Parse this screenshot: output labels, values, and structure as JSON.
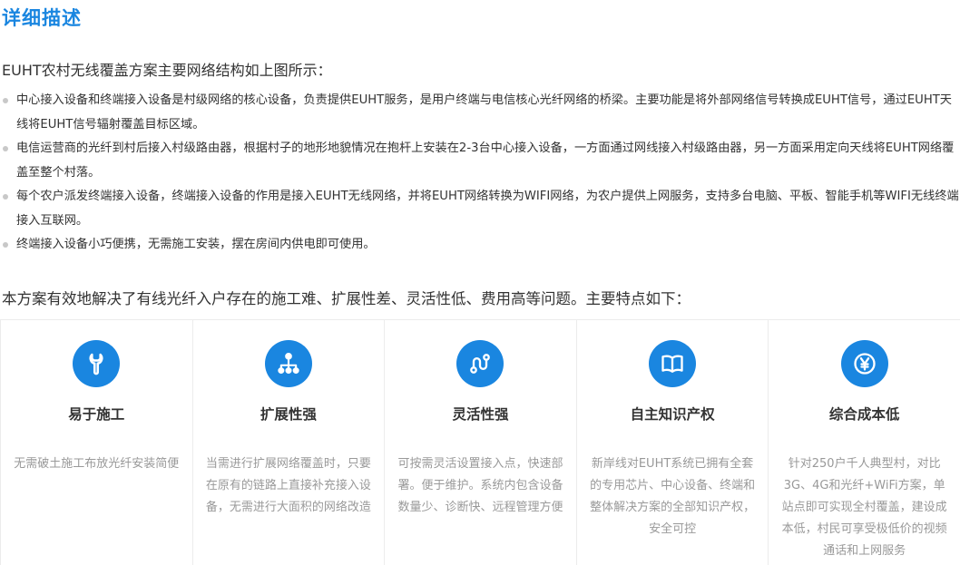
{
  "title": "详细描述",
  "intro": "EUHT农村无线覆盖方案主要网络结构如上图所示：",
  "bullets": [
    "中心接入设备和终端接入设备是村级网络的核心设备，负责提供EUHT服务，是用户终端与电信核心光纤网络的桥梁。主要功能是将外部网络信号转换成EUHT信号，通过EUHT天线将EUHT信号辐射覆盖目标区域。",
    "电信运营商的光纤到村后接入村级路由器，根据村子的地形地貌情况在抱杆上安装在2-3台中心接入设备，一方面通过网线接入村级路由器，另一方面采用定向天线将EUHT网络覆盖至整个村落。",
    "每个农户派发终端接入设备，终端接入设备的作用是接入EUHT无线网络，并将EUHT网络转换为WIFI网络，为农户提供上网服务，支持多台电脑、平板、智能手机等WIFI无线终端接入互联网。",
    "终端接入设备小巧便携，无需施工安装，摆在房间内供电即可使用。"
  ],
  "lead": "本方案有效地解决了有线光纤入户存在的施工难、扩展性差、灵活性低、费用高等问题。主要特点如下：",
  "features": [
    {
      "icon": "wrench-icon",
      "title": "易于施工",
      "desc": "无需破土施工布放光纤安装简便"
    },
    {
      "icon": "network-tree-icon",
      "title": "扩展性强",
      "desc": "当需进行扩展网络覆盖时，只要在原有的链路上直接补充接入设备，无需进行大面积的网络改造"
    },
    {
      "icon": "route-icon",
      "title": "灵活性强",
      "desc": "可按需灵活设置接入点，快速部署。便于维护。系统内包含设备数量少、诊断快、远程管理方便"
    },
    {
      "icon": "book-icon",
      "title": "自主知识产权",
      "desc": "新岸线对EUHT系统已拥有全套的专用芯片、中心设备、终端和整体解决方案的全部知识产权，安全可控"
    },
    {
      "icon": "yen-coin-icon",
      "title": "综合成本低",
      "desc": "针对250户千人典型村，对比3G、4G和光纤+WiFi方案，单站点即可实现全村覆盖，建设成本低，村民可享受极低价的视频通话和上网服务"
    }
  ],
  "colors": {
    "accent": "#1a86e0",
    "text": "#333333",
    "muted": "#999999",
    "border": "#ececec"
  }
}
